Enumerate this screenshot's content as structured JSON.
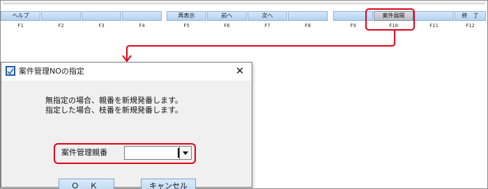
{
  "toolbar": {
    "keys": [
      {
        "label": "ヘルプ",
        "key": "F1"
      },
      {
        "label": "",
        "key": "F2"
      },
      {
        "label": "",
        "key": "F3"
      },
      {
        "label": "",
        "key": "F4"
      },
      {
        "label": "再表示",
        "key": "F5"
      },
      {
        "label": "前へ",
        "key": "F6"
      },
      {
        "label": "次へ",
        "key": "F7"
      },
      {
        "label": "",
        "key": "F8"
      },
      {
        "label": "",
        "key": "F9"
      },
      {
        "label": "案件展開",
        "key": "F10"
      },
      {
        "label": "",
        "key": "F11"
      },
      {
        "label": "終　了",
        "key": "F12"
      }
    ]
  },
  "dialog": {
    "title": "案件管理NOの指定",
    "close": "✕",
    "message_line1": "無指定の場合、親番を新規発番します。",
    "message_line2": "指定した場合、枝番を新規発番します。",
    "field_label": "案件管理親番",
    "field_value": "",
    "ok_label": "Ｏ Ｋ",
    "cancel_label": "キャンセル"
  },
  "colors": {
    "highlight": "#e0001a",
    "button_top": "#d6e8fa",
    "button_bottom": "#b4d2f0"
  }
}
